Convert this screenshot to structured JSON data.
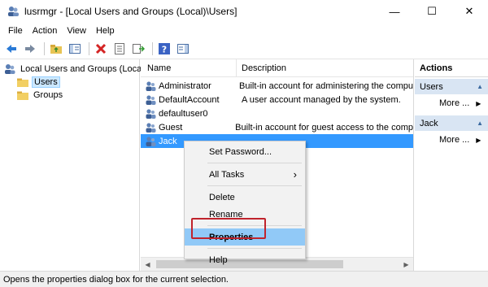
{
  "window": {
    "title": "lusrmgr - [Local Users and Groups (Local)\\Users]",
    "minimize_glyph": "—",
    "maximize_glyph": "☐",
    "close_glyph": "✕"
  },
  "menubar": {
    "items": [
      "File",
      "Action",
      "View",
      "Help"
    ]
  },
  "toolbar": {
    "icons": [
      "back-arrow-icon",
      "forward-arrow-icon",
      "up-folder-icon",
      "show-hide-tree-icon",
      "delete-icon",
      "properties-icon",
      "export-list-icon",
      "help-icon",
      "show-hide-action-pane-icon"
    ]
  },
  "tree": {
    "root": "Local Users and Groups (Local)",
    "items": [
      {
        "label": "Users",
        "selected": true
      },
      {
        "label": "Groups",
        "selected": false
      }
    ]
  },
  "list": {
    "columns": [
      "Name",
      "Description"
    ],
    "rows": [
      {
        "name": "Administrator",
        "description": "Built-in account for administering the compu"
      },
      {
        "name": "DefaultAccount",
        "description": "A user account managed by the system."
      },
      {
        "name": "defaultuser0",
        "description": ""
      },
      {
        "name": "Guest",
        "description": "Built-in account for guest access to the comp"
      },
      {
        "name": "Jack",
        "description": "",
        "selected": true
      }
    ]
  },
  "actions": {
    "header": "Actions",
    "groups": [
      {
        "title": "Users",
        "item": "More ..."
      },
      {
        "title": "Jack",
        "item": "More ..."
      }
    ]
  },
  "context_menu": {
    "items": [
      {
        "label": "Set Password...",
        "type": "item"
      },
      {
        "type": "separator"
      },
      {
        "label": "All Tasks",
        "type": "submenu"
      },
      {
        "type": "separator"
      },
      {
        "label": "Delete",
        "type": "item"
      },
      {
        "label": "Rename",
        "type": "item"
      },
      {
        "type": "separator"
      },
      {
        "label": "Properties",
        "type": "item",
        "highlighted": true
      },
      {
        "type": "separator"
      },
      {
        "label": "Help",
        "type": "item"
      }
    ],
    "submenu_glyph": "›"
  },
  "statusbar": {
    "text": "Opens the properties dialog box for the current selection."
  },
  "colors": {
    "selection": "#3399ff",
    "menu_hover": "#91c9f7",
    "annotation_box": "#c0232c",
    "actions_group": "#d9e5f3"
  }
}
